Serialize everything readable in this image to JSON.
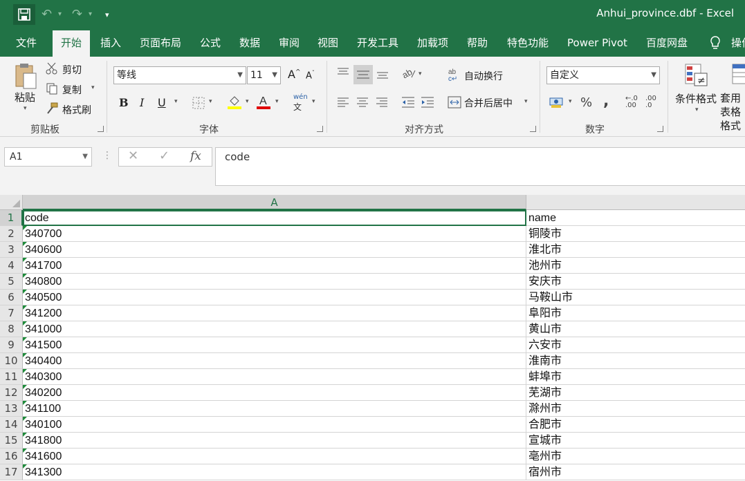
{
  "titlebar": {
    "title": "Anhui_province.dbf  -  Excel",
    "quick_access": {
      "save": "save-icon",
      "undo": "↶",
      "redo": "↷",
      "customize": "▾"
    }
  },
  "tabs": [
    "文件",
    "开始",
    "插入",
    "页面布局",
    "公式",
    "数据",
    "审阅",
    "视图",
    "开发工具",
    "加载项",
    "帮助",
    "特色功能",
    "Power Pivot",
    "百度网盘",
    "操作"
  ],
  "active_tab": "开始",
  "ribbon": {
    "clipboard": {
      "paste": "粘贴",
      "cut": "剪切",
      "copy": "复制",
      "format_painter": "格式刷",
      "label": "剪贴板"
    },
    "font": {
      "font_name": "等线",
      "font_size": "11",
      "bold": "B",
      "italic": "I",
      "underline": "U",
      "label": "字体",
      "grow": "A",
      "shrink": "A",
      "phonetic": "wén"
    },
    "alignment": {
      "wrap": "自动换行",
      "merge": "合并后居中",
      "label": "对齐方式"
    },
    "number": {
      "format": "自定义",
      "percent": "%",
      "comma": ",",
      "inc": ".00",
      "dec": ".0",
      "label": "数字"
    },
    "styles": {
      "conditional": "条件格式",
      "table": "套用表格格式"
    }
  },
  "formula_bar": {
    "name_box": "A1",
    "cancel": "✕",
    "enter": "✓",
    "fx": "fx",
    "content": "code"
  },
  "grid": {
    "columns": [
      "A"
    ],
    "rows": [
      {
        "n": "1",
        "a": "code",
        "b": "name"
      },
      {
        "n": "2",
        "a": "340700",
        "b": "铜陵市"
      },
      {
        "n": "3",
        "a": "340600",
        "b": "淮北市"
      },
      {
        "n": "4",
        "a": "341700",
        "b": "池州市"
      },
      {
        "n": "5",
        "a": "340800",
        "b": "安庆市"
      },
      {
        "n": "6",
        "a": "340500",
        "b": "马鞍山市"
      },
      {
        "n": "7",
        "a": "341200",
        "b": "阜阳市"
      },
      {
        "n": "8",
        "a": "341000",
        "b": "黄山市"
      },
      {
        "n": "9",
        "a": "341500",
        "b": "六安市"
      },
      {
        "n": "10",
        "a": "340400",
        "b": "淮南市"
      },
      {
        "n": "11",
        "a": "340300",
        "b": "蚌埠市"
      },
      {
        "n": "12",
        "a": "340200",
        "b": "芜湖市"
      },
      {
        "n": "13",
        "a": "341100",
        "b": "滁州市"
      },
      {
        "n": "14",
        "a": "340100",
        "b": "合肥市"
      },
      {
        "n": "15",
        "a": "341800",
        "b": "宣城市"
      },
      {
        "n": "16",
        "a": "341600",
        "b": "亳州市"
      },
      {
        "n": "17",
        "a": "341300",
        "b": "宿州市"
      }
    ]
  },
  "colors": {
    "accent": "#217346",
    "ribbon_bg": "#f3f3f3",
    "error_triangle": "#1e8b3a"
  }
}
